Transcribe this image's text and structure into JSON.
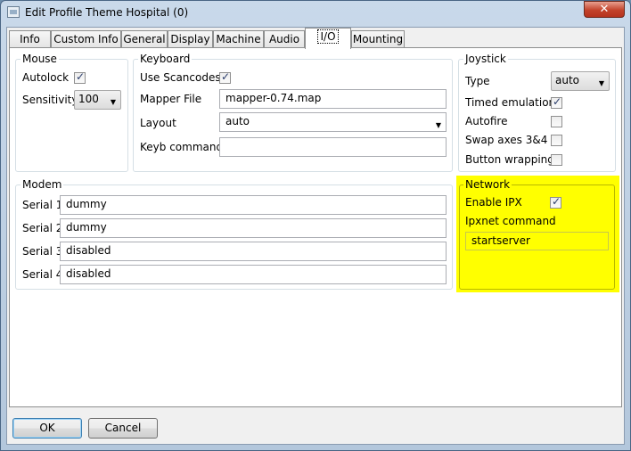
{
  "window": {
    "title": "Edit Profile Theme Hospital (0)",
    "close_glyph": "✕"
  },
  "tabs": [
    {
      "label": "Info"
    },
    {
      "label": "Custom Info"
    },
    {
      "label": "General"
    },
    {
      "label": "Display"
    },
    {
      "label": "Machine"
    },
    {
      "label": "Audio"
    },
    {
      "label": "I/O",
      "active": true
    },
    {
      "label": "Mounting"
    }
  ],
  "mouse": {
    "title": "Mouse",
    "autolock_label": "Autolock",
    "autolock_checked": true,
    "sensitivity_label": "Sensitivity",
    "sensitivity_value": "100"
  },
  "keyboard": {
    "title": "Keyboard",
    "use_scancodes_label": "Use Scancodes",
    "use_scancodes_checked": true,
    "mapper_file_label": "Mapper File",
    "mapper_file_value": "mapper-0.74.map",
    "layout_label": "Layout",
    "layout_value": "auto",
    "keyb_command_label": "Keyb command",
    "keyb_command_value": ""
  },
  "joystick": {
    "title": "Joystick",
    "type_label": "Type",
    "type_value": "auto",
    "timed_emulation_label": "Timed emulation",
    "timed_emulation_checked": true,
    "autofire_label": "Autofire",
    "autofire_checked": false,
    "swap_axes_label": "Swap axes 3&4",
    "swap_axes_checked": false,
    "button_wrapping_label": "Button wrapping",
    "button_wrapping_checked": false
  },
  "modem": {
    "title": "Modem",
    "serials": [
      {
        "label": "Serial 1",
        "value": "dummy"
      },
      {
        "label": "Serial 2",
        "value": "dummy"
      },
      {
        "label": "Serial 3",
        "value": "disabled"
      },
      {
        "label": "Serial 4",
        "value": "disabled"
      }
    ]
  },
  "network": {
    "title": "Network",
    "enable_ipx_label": "Enable IPX",
    "enable_ipx_checked": true,
    "ipxnet_command_label": "Ipxnet command",
    "ipxnet_command_value": "startserver",
    "highlight_color": "#ffff00"
  },
  "footer": {
    "ok_label": "OK",
    "cancel_label": "Cancel"
  },
  "colors": {
    "window_frame": "#b9cde2",
    "close_button": "#c3432b",
    "highlight": "#ffff00"
  }
}
